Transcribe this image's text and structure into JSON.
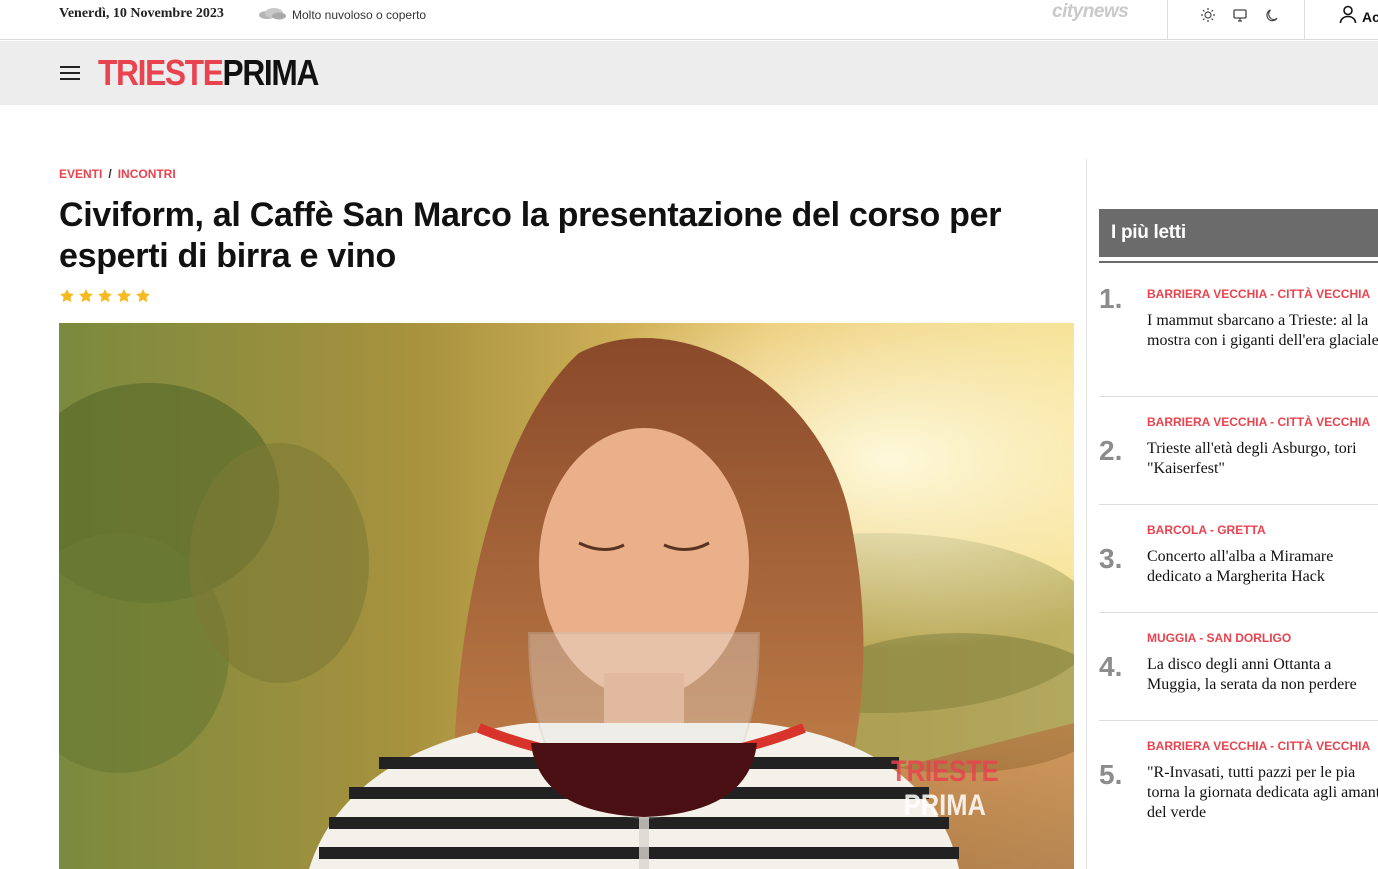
{
  "topbar": {
    "date": "Venerdì, 10 Novembre 2023",
    "weather_icon": "cloud-icon",
    "weather": "Molto nuvoloso o coperto",
    "network_logo": "citynews",
    "theme_icons": [
      "sun-icon",
      "monitor-icon",
      "moon-icon"
    ],
    "account_label": "Ac"
  },
  "header": {
    "logo_part1": "TRIESTE",
    "logo_part2": "PRIMA"
  },
  "article": {
    "breadcrumb": [
      "EVENTI",
      "INCONTRI"
    ],
    "title": "Civiform, al Caffè San Marco la presentazione del corso per esperti di birra e vino",
    "rating_stars": 5,
    "image_watermark_1": "TRIESTE",
    "image_watermark_2": "PRIMA"
  },
  "sidebar": {
    "title": "I più letti",
    "items": [
      {
        "num": "1.",
        "category": "BARRIERA VECCHIA - CITTÀ VECCHIA",
        "title": "I mammut sbarcano a Trieste: al la mostra con i giganti dell'era glaciale"
      },
      {
        "num": "2.",
        "category": "BARRIERA VECCHIA - CITTÀ VECCHIA",
        "title": "Trieste all'età degli Asburgo, tori \"Kaiserfest\""
      },
      {
        "num": "3.",
        "category": "BARCOLA - GRETTA",
        "title": "Concerto all'alba a Miramare dedicato a Margherita Hack"
      },
      {
        "num": "4.",
        "category": "MUGGIA - SAN DORLIGO",
        "title": "La disco degli anni Ottanta a Muggia, la serata da non perdere"
      },
      {
        "num": "5.",
        "category": "BARRIERA VECCHIA - CITTÀ VECCHIA",
        "title": "\"R-Invasati, tutti pazzi per le pia torna la giornata dedicata agli amanti del verde"
      }
    ]
  },
  "colors": {
    "accent": "#e8434e",
    "header_bg": "#ededed",
    "sidebar_header_bg": "#6b6b6b",
    "star": "#f5b921"
  }
}
